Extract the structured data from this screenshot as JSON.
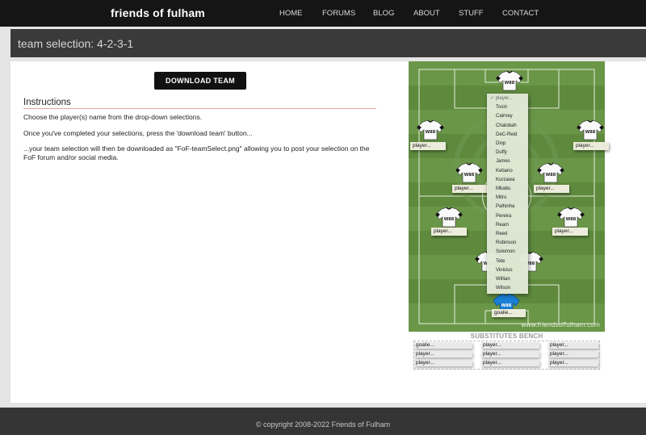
{
  "site": {
    "brand": "friends of fulham"
  },
  "nav": {
    "items": [
      {
        "label": "HOME"
      },
      {
        "label": "FORUMS"
      },
      {
        "label": "BLOG"
      },
      {
        "label": "ABOUT"
      },
      {
        "label": "STUFF"
      },
      {
        "label": "CONTACT"
      }
    ]
  },
  "page": {
    "title": "team selection: 4-2-3-1"
  },
  "download_button": {
    "label": "DOWNLOAD TEAM"
  },
  "instructions": {
    "heading": "Instructions",
    "paragraphs": [
      "Choose the player(s) name from the drop-down selections.",
      "Once you've completed your selections, press the 'download team' button...",
      "...your team selection will then be downloaded as \"FoF-teamSelect.png\" allowing you to post your selection on the FoF forum and/or social media."
    ]
  },
  "pitch": {
    "shirt_sponsor": "W88",
    "watermark": "www.friendsoffulham.com",
    "slots": {
      "striker": "player...",
      "left_wing": "player...",
      "right_wing": "player...",
      "left_mid": "player...",
      "right_mid": "player...",
      "left_back": "player...",
      "right_back": "player...",
      "goalkeeper": "goalie..."
    },
    "dropdown": {
      "selected": "✓ player...",
      "options": [
        "Tosin",
        "Cairney",
        "Chalobah",
        "DeC-Reid",
        "Diop",
        "Duffy",
        "James",
        "Kebano",
        "Kurzawa",
        "Mbabu",
        "Mitro",
        "Palhinha",
        "Pereira",
        "Ream",
        "Reed",
        "Robinson",
        "Solomon",
        "Tete",
        "Vinicius",
        "Willian",
        "Wilson"
      ]
    }
  },
  "bench": {
    "title": "SUBSTITUTES BENCH",
    "columns": [
      [
        "goalie...",
        "player...",
        "player..."
      ],
      [
        "player...",
        "player...",
        "player..."
      ],
      [
        "player...",
        "player...",
        "player..."
      ]
    ]
  },
  "footer": {
    "copyright": "© copyright 2008-2022 Friends of Fulham"
  },
  "colors": {
    "nav_bg": "#151515",
    "title_band": "#3a3a3a",
    "pitch_green": "#5f8a3e",
    "pitch_green_light": "#6a9747",
    "accent_rule": "#e6a79b",
    "keeper_shirt": "#1a7fd6"
  }
}
